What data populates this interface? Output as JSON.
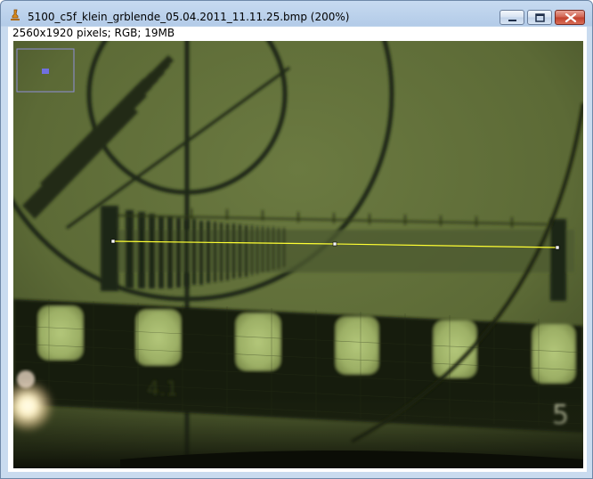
{
  "window": {
    "title": "5100_c5f_klein_grblende_05.04.2011_11.11.25.bmp (200%)",
    "app_icon": "microscope-icon",
    "buttons": {
      "minimize": "minimize-icon",
      "maximize": "maximize-icon",
      "close": "close-icon"
    }
  },
  "image_info": "2560x1920 pixels; RGB; 19MB",
  "image": {
    "scale_digits": [
      "4.1",
      "5"
    ],
    "line_selection_color": "#ffff33"
  },
  "colors": {
    "frame": "#c3d7ee",
    "close_button": "#c8412e",
    "navigator_outline": "#8f8fd8",
    "navigator_fill": "#7070e0"
  }
}
